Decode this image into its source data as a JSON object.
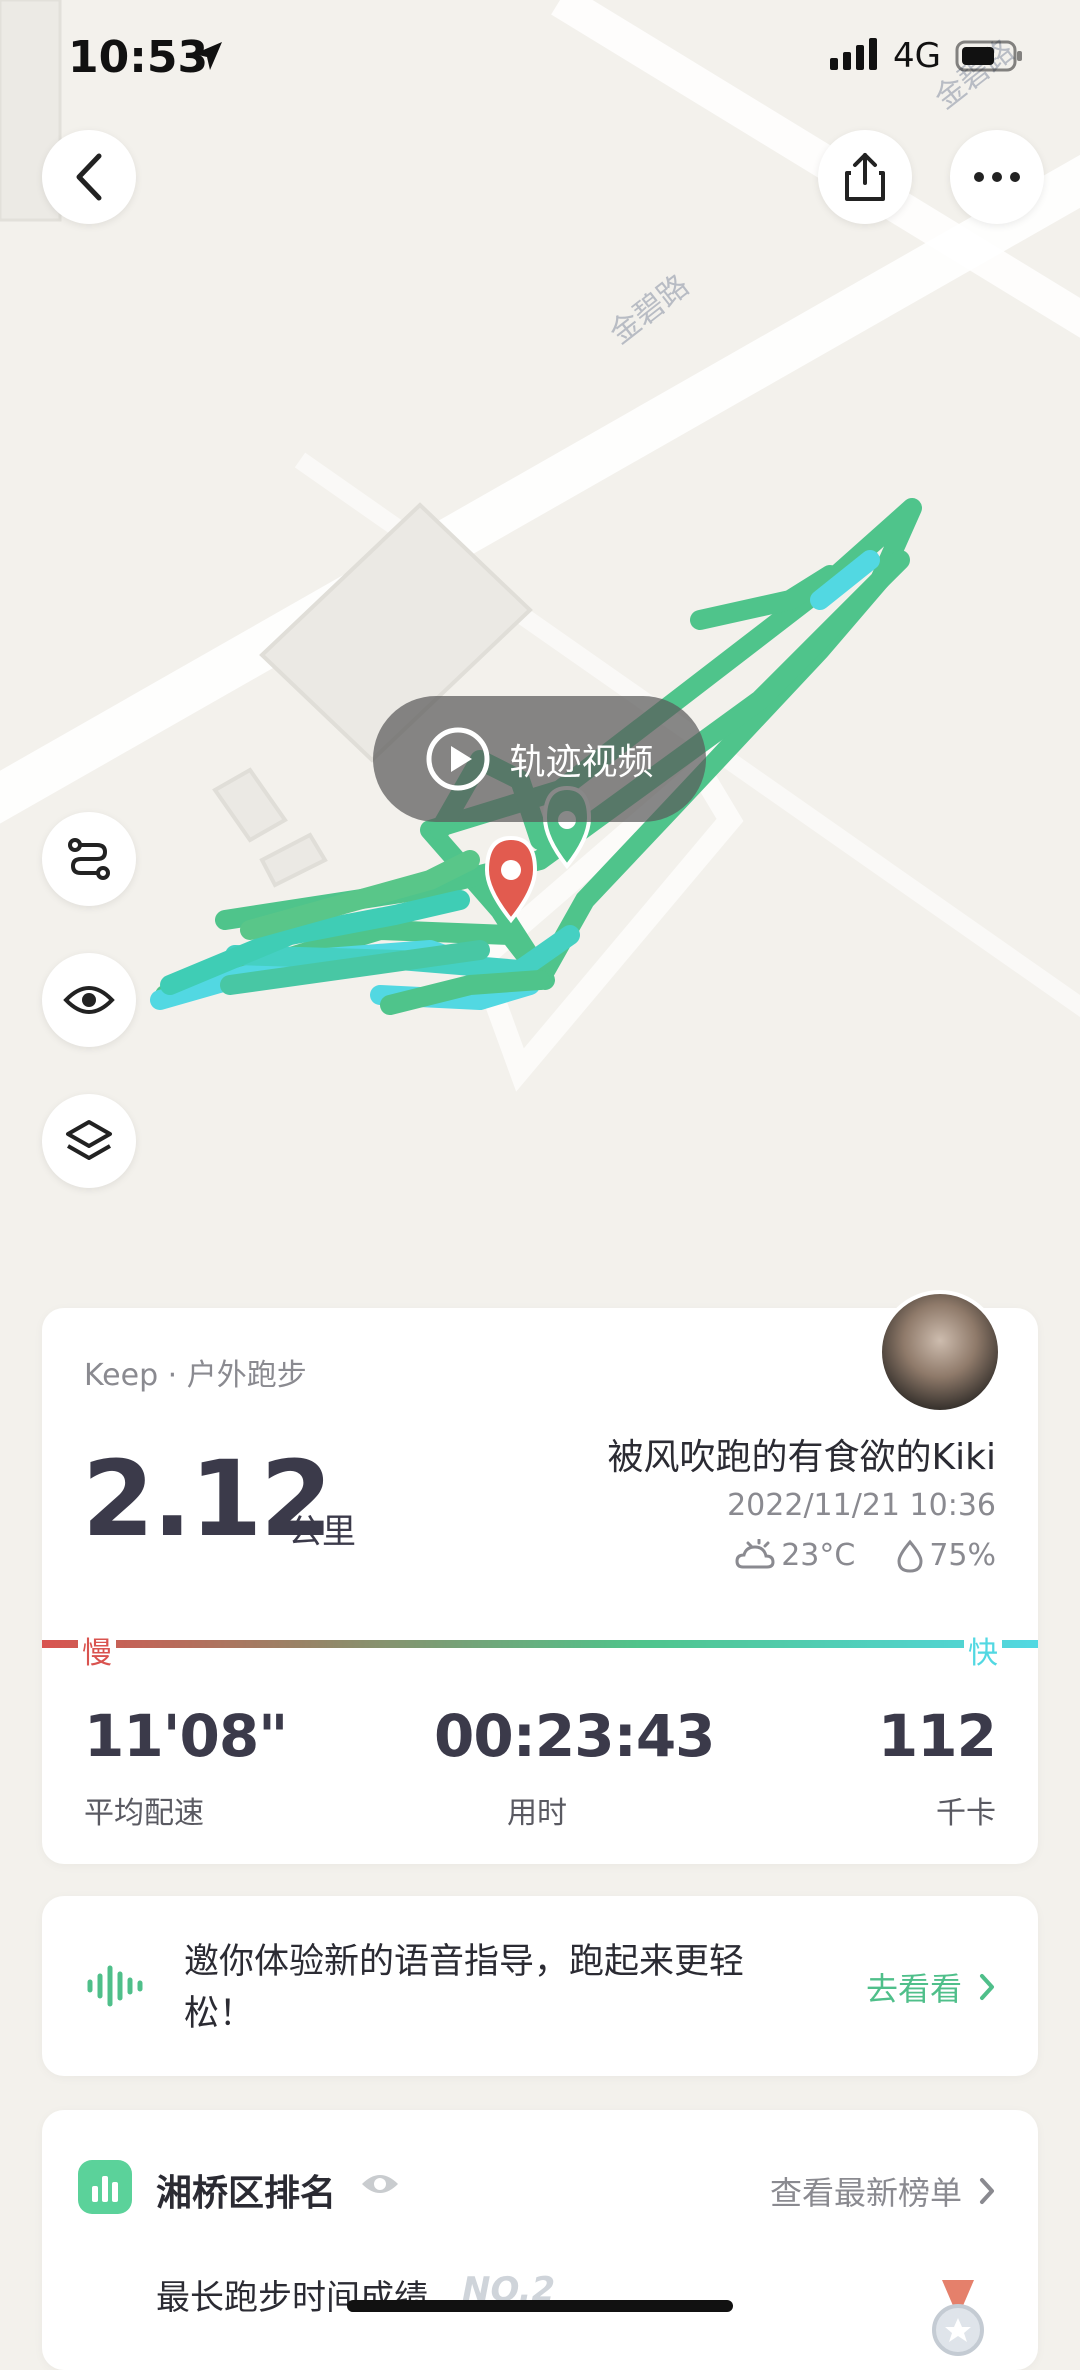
{
  "status_bar": {
    "time": "10:53",
    "network": "4G"
  },
  "map": {
    "road_labels": [
      "金碧路",
      "金碧路"
    ],
    "video_button_label": "轨迹视频",
    "route_colors": {
      "slow": "#4fc48b",
      "fast": "#52d8e2",
      "start_pin": "#e25b4f",
      "end_pin": "#4fc48b"
    }
  },
  "toolbar": {
    "back_icon": "chevron-left-icon",
    "share_icon": "share-icon",
    "more_icon": "more-dots-icon"
  },
  "side_tools": [
    "route-icon",
    "eye-icon",
    "layers-icon"
  ],
  "summary": {
    "source": "Keep · 户外跑步",
    "distance": "2.12",
    "distance_unit": "公里",
    "nickname": "被风吹跑的有食欲的Kiki",
    "datetime": "2022/11/21 10:36",
    "temperature": "23°C",
    "humidity": "75%",
    "pace_slow_label": "慢",
    "pace_fast_label": "快",
    "stats": [
      {
        "value": "11'08\"",
        "label": "平均配速"
      },
      {
        "value": "00:23:43",
        "label": "用时"
      },
      {
        "value": "112",
        "label": "千卡"
      }
    ]
  },
  "voice_card": {
    "text": "邀你体验新的语音指导，跑起来更轻松！",
    "link": "去看看"
  },
  "rank_card": {
    "title": "湘桥区排名",
    "link": "查看最新榜单",
    "subtitle": "最长跑步时间成绩",
    "rank": "NO.2"
  },
  "colors": {
    "accent": "#4fbf8a",
    "pace_slow": "#d9534f",
    "pace_fast": "#52d8e2"
  }
}
